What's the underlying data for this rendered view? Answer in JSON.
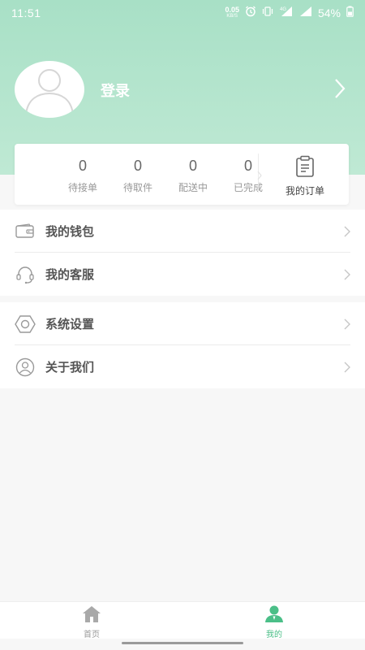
{
  "status": {
    "time": "11:51",
    "net_speed": "0.05",
    "net_unit": "KB/S",
    "network": "4G",
    "battery": "54%"
  },
  "profile": {
    "login": "登录"
  },
  "orders": {
    "stats": [
      {
        "count": "0",
        "label": "待接单"
      },
      {
        "count": "0",
        "label": "待取件"
      },
      {
        "count": "0",
        "label": "配送中"
      },
      {
        "count": "0",
        "label": "已完成"
      }
    ],
    "my_orders": "我的订单"
  },
  "menu": {
    "wallet": "我的钱包",
    "service": "我的客服",
    "settings": "系统设置",
    "about": "关于我们"
  },
  "tabbar": {
    "home": "首页",
    "mine": "我的"
  },
  "colors": {
    "accent": "#4bbf88",
    "header": "#a8e0c6"
  },
  "icons": [
    "wallet-icon",
    "headset-icon",
    "settings-icon",
    "user-circle-icon",
    "home-icon",
    "user-icon",
    "clipboard-icon"
  ]
}
